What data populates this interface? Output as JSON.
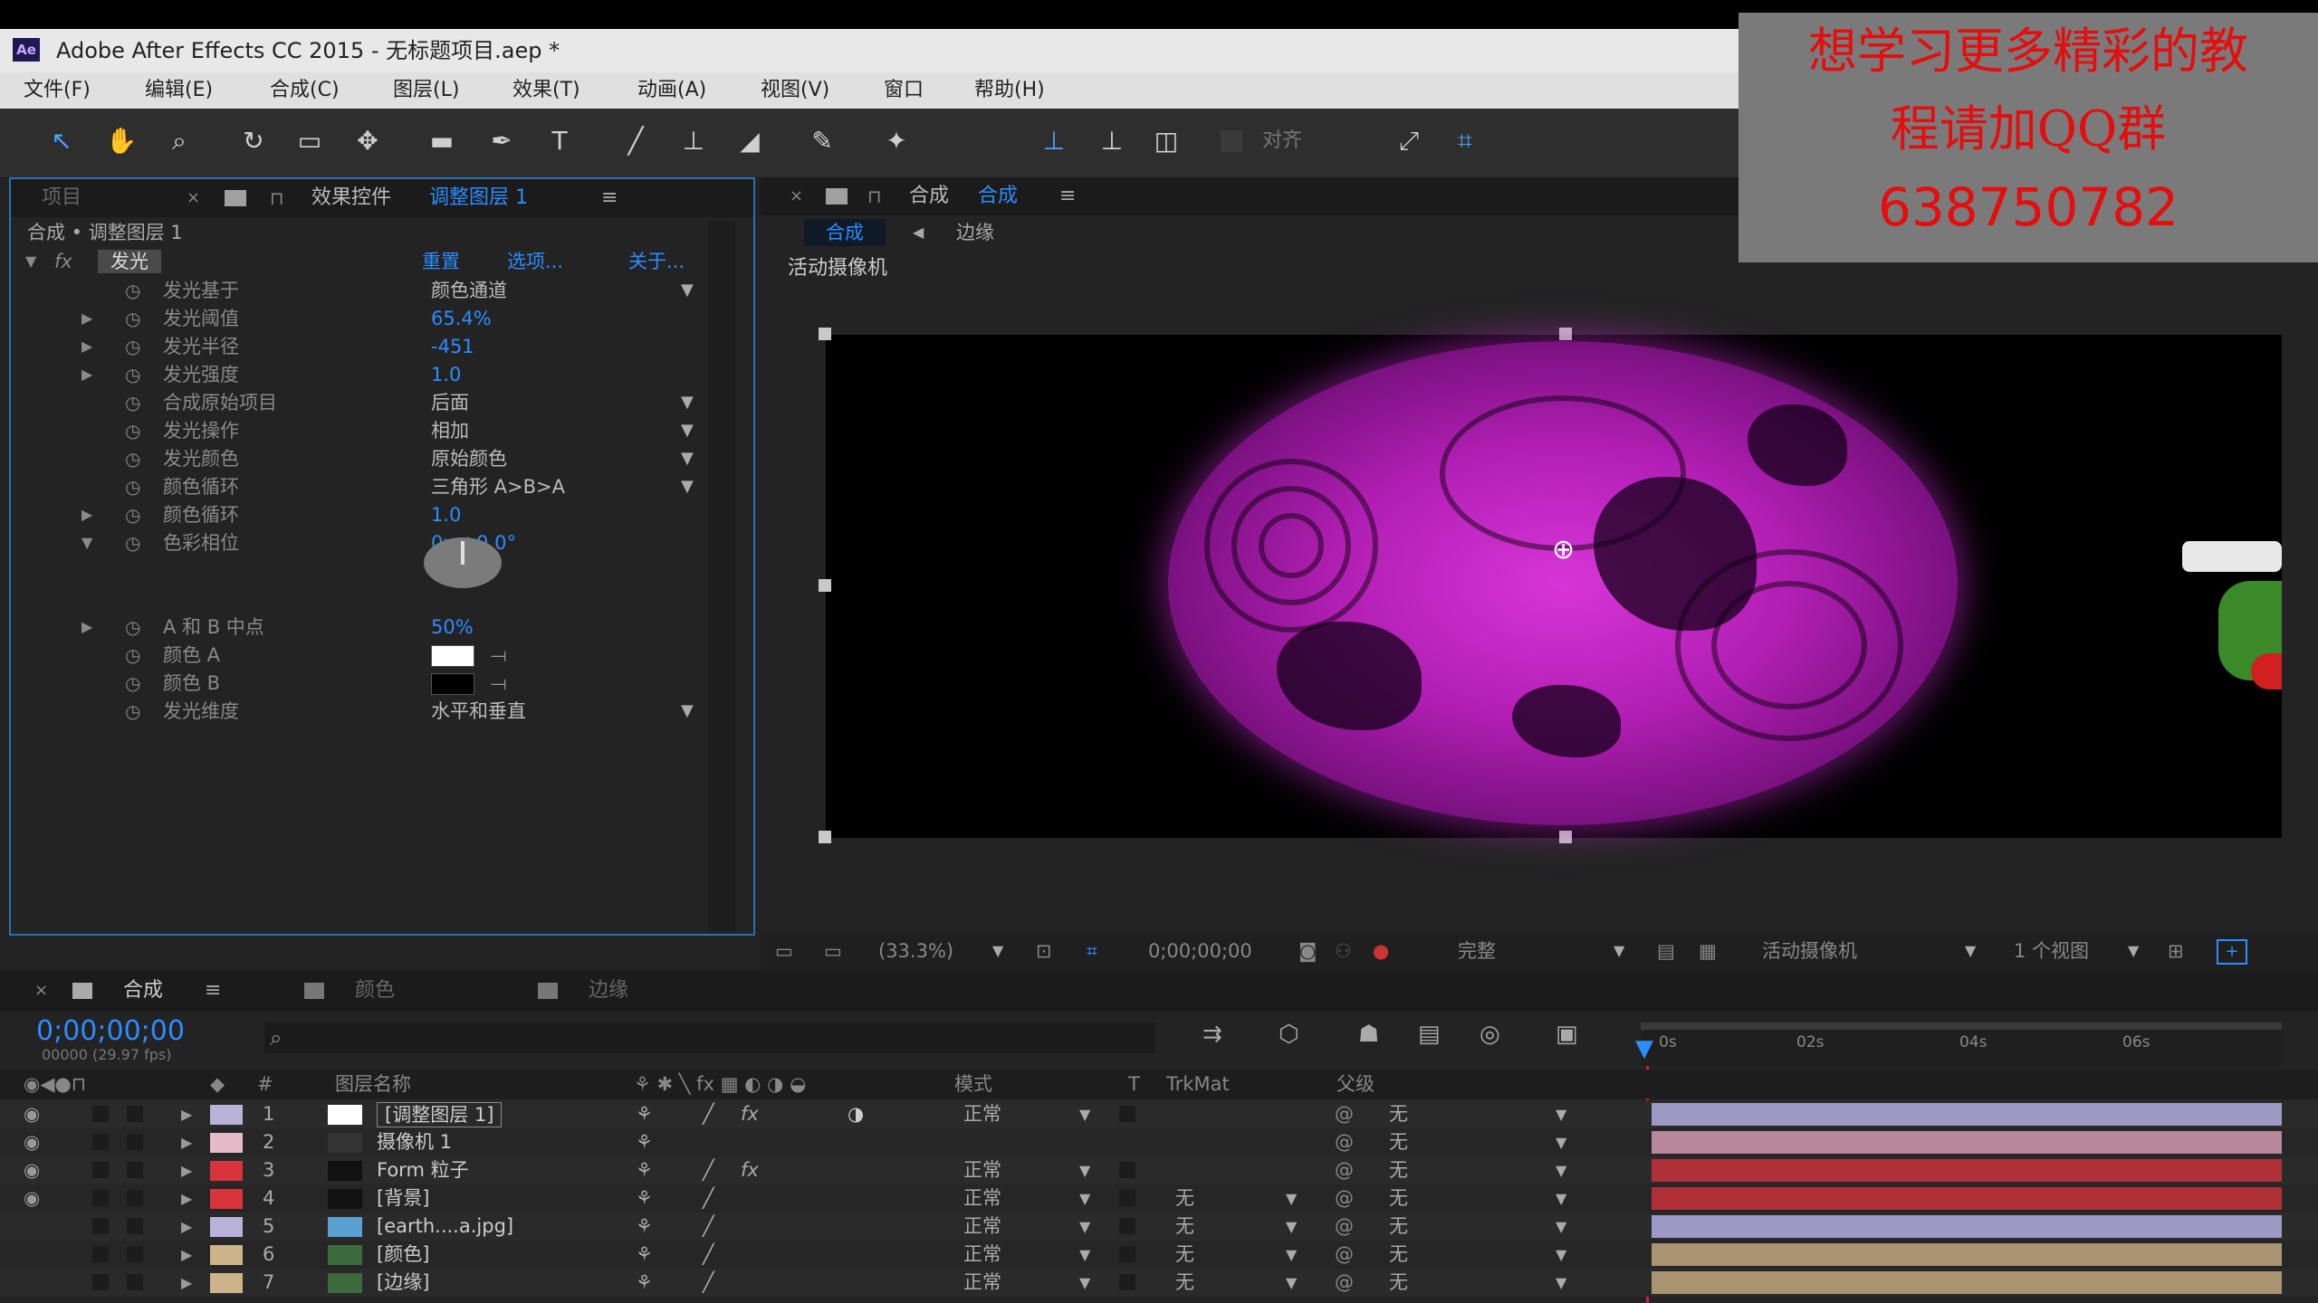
{
  "window": {
    "title": "Adobe After Effects CC 2015 - 无标题项目.aep *",
    "logo": "Ae"
  },
  "menu": [
    "文件(F)",
    "编辑(E)",
    "合成(C)",
    "图层(L)",
    "效果(T)",
    "动画(A)",
    "视图(V)",
    "窗口",
    "帮助(H)"
  ],
  "toolbar": {
    "snap_label": "对齐"
  },
  "effects_panel": {
    "tab_project": "项目",
    "tab_effects": "效果控件",
    "tab_effects_layer": "调整图层 1",
    "breadcrumb": "合成 • 调整图层 1",
    "effect_name": "发光",
    "effect_links": [
      "重置",
      "选项...",
      "关于..."
    ],
    "properties": [
      {
        "name": "发光基于",
        "value": "颜色通道",
        "dropdown": true
      },
      {
        "name": "发光阈值",
        "value": "65.4%",
        "dropdown": false
      },
      {
        "name": "发光半径",
        "value": -451.0,
        "dropdown": false
      },
      {
        "name": "发光强度",
        "value": "1.0",
        "dropdown": false
      },
      {
        "name": "合成原始项目",
        "value": "后面",
        "dropdown": true
      },
      {
        "name": "发光操作",
        "value": "相加",
        "dropdown": true
      },
      {
        "name": "发光颜色",
        "value": "原始颜色",
        "dropdown": true
      },
      {
        "name": "颜色循环",
        "value": "三角形 A>B>A",
        "dropdown": true
      },
      {
        "name": "颜色循环",
        "value": "1.0",
        "dropdown": false
      },
      {
        "name": "色彩相位",
        "value": "0x +0.0°",
        "dropdown": false
      },
      {
        "name": "A 和 B 中点",
        "value": "50%",
        "dropdown": false
      },
      {
        "name": "颜色 A",
        "value": "",
        "dropdown": false
      },
      {
        "name": "颜色 B",
        "value": "",
        "dropdown": false
      },
      {
        "name": "发光维度",
        "value": "水平和垂直",
        "dropdown": true
      }
    ],
    "color_a": "#ffffff",
    "color_b": "#000000"
  },
  "viewer": {
    "tab_label": "合成",
    "tab_comp_name": "合成",
    "sub_tab_active": "合成",
    "sub_tab_other": "边缘",
    "camera_label": "活动摄像机",
    "zoom": "(33.3%)",
    "timecode": "0;00;00;00",
    "quality": "完整",
    "camera_select": "活动摄像机",
    "views": "1 个视图"
  },
  "timeline": {
    "tabs": [
      "合成",
      "颜色",
      "边缘"
    ],
    "timecode": "0;00;00;00",
    "frame_info": "00000 (29.97 fps)",
    "headers": {
      "layer_name": "图层名称",
      "mode": "模式",
      "t": "T",
      "trkmat": "TrkMat",
      "parent": "父级"
    },
    "ruler": [
      "0s",
      "02s",
      "04s",
      "06s"
    ],
    "layers": [
      {
        "num": "1",
        "name": "[调整图层 1]",
        "label_color": "#b9b3d9",
        "mode": "正常",
        "trkmat": "",
        "parent": "无",
        "bar_color": "#9e99c4"
      },
      {
        "num": "2",
        "name": "摄像机 1",
        "label_color": "#e6b9c8",
        "mode": "",
        "trkmat": "",
        "parent": "无",
        "bar_color": "#b8879a"
      },
      {
        "num": "3",
        "name": "Form 粒子",
        "label_color": "#d9333b",
        "mode": "正常",
        "trkmat": "",
        "parent": "无",
        "bar_color": "#b03037"
      },
      {
        "num": "4",
        "name": "[背景]",
        "label_color": "#d9333b",
        "mode": "正常",
        "trkmat": "无",
        "parent": "无",
        "bar_color": "#b03037"
      },
      {
        "num": "5",
        "name": "[earth....a.jpg]",
        "label_color": "#b9b3d9",
        "mode": "正常",
        "trkmat": "无",
        "parent": "无",
        "bar_color": "#9e99c4"
      },
      {
        "num": "6",
        "name": "[颜色]",
        "label_color": "#cdb38a",
        "mode": "正常",
        "trkmat": "无",
        "parent": "无",
        "bar_color": "#a89471"
      },
      {
        "num": "7",
        "name": "[边缘]",
        "label_color": "#cdb38a",
        "mode": "正常",
        "trkmat": "无",
        "parent": "无",
        "bar_color": "#a89471"
      }
    ]
  },
  "overlay": {
    "line1": "想学习更多精彩的教",
    "line2": "程请加QQ群",
    "line3": "638750782"
  }
}
